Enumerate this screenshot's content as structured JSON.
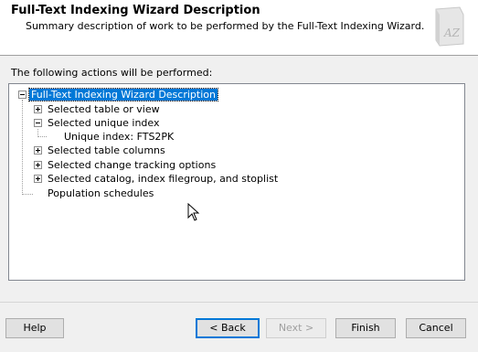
{
  "header": {
    "title": "Full-Text Indexing Wizard Description",
    "subtitle": "Summary description of work to be performed by the Full-Text Indexing Wizard.",
    "logo_icon": "book-az-icon",
    "logo_text": "AZ"
  },
  "actions_label": "The following actions will be performed:",
  "tree": {
    "root": "Full-Text Indexing Wizard Description",
    "items": [
      "Selected table or view",
      "Selected unique index",
      "Unique index: FTS2PK",
      "Selected table columns",
      "Selected change tracking options",
      "Selected catalog, index filegroup, and stoplist",
      "Population schedules"
    ]
  },
  "buttons": {
    "help": "Help",
    "back": "< Back",
    "next": "Next >",
    "finish": "Finish",
    "cancel": "Cancel"
  },
  "colors": {
    "selection": "#0078d7"
  }
}
